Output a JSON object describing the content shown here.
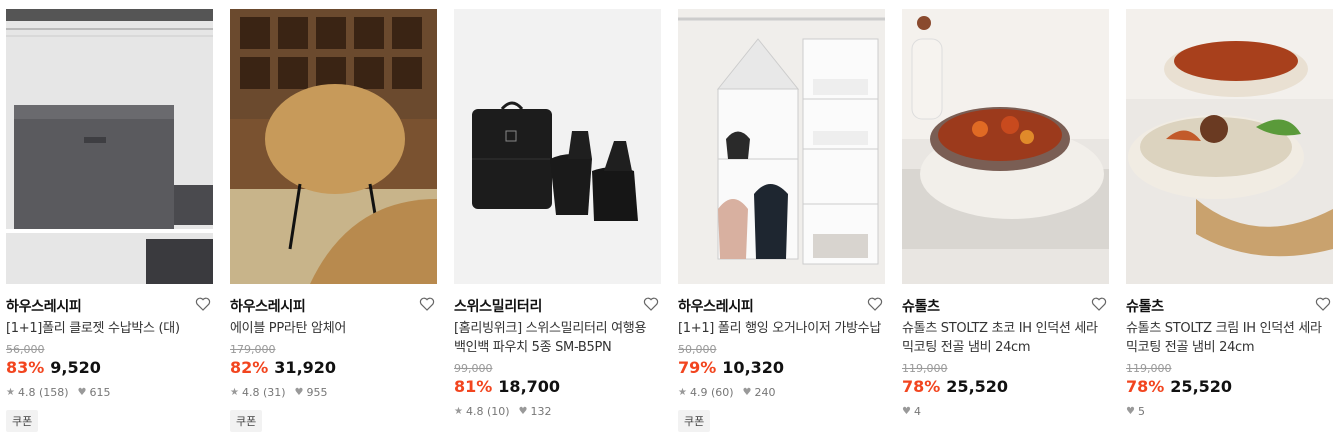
{
  "products": [
    {
      "brand": "하우스레시피",
      "name": "[1+1]폴리 클로젯 수납박스 (대)",
      "original_price": "56,000",
      "discount": "83%",
      "price": "9,520",
      "rating": "4.8 (158)",
      "likes": "615",
      "badge": "쿠폰",
      "image_icon": "storage-box-image"
    },
    {
      "brand": "하우스레시피",
      "name": "에이블 PP라탄 암체어",
      "original_price": "179,000",
      "discount": "82%",
      "price": "31,920",
      "rating": "4.8 (31)",
      "likes": "955",
      "badge": "쿠폰",
      "image_icon": "rattan-chair-image"
    },
    {
      "brand": "스위스밀리터리",
      "name": "[홈리빙위크] 스위스밀리터리 여행용 백인백 파우치 5종 SM-B5PN",
      "original_price": "99,000",
      "discount": "81%",
      "price": "18,700",
      "rating": "4.8 (10)",
      "likes": "132",
      "badge": "",
      "image_icon": "travel-pouch-image"
    },
    {
      "brand": "하우스레시피",
      "name": "[1+1] 폴리 행잉 오거나이저 가방수납",
      "original_price": "50,000",
      "discount": "79%",
      "price": "10,320",
      "rating": "4.9 (60)",
      "likes": "240",
      "badge": "쿠폰",
      "image_icon": "hanging-organizer-image"
    },
    {
      "brand": "슈톨츠",
      "name": "슈톨츠 STOLTZ 초코 IH 인덕션 세라믹코팅 전골 냄비 24cm",
      "original_price": "119,000",
      "discount": "78%",
      "price": "25,520",
      "rating": "",
      "likes": "4",
      "badge": "",
      "image_icon": "choco-pot-image"
    },
    {
      "brand": "슈톨츠",
      "name": "슈톨츠 STOLTZ 크림 IH 인덕션 세라믹코팅 전골 냄비 24cm",
      "original_price": "119,000",
      "discount": "78%",
      "price": "25,520",
      "rating": "",
      "likes": "5",
      "badge": "",
      "image_icon": "cream-pot-image"
    }
  ],
  "colors": {
    "discount": "#f2451f",
    "strikethrough": "#9a9a9a",
    "meta": "#777777"
  }
}
